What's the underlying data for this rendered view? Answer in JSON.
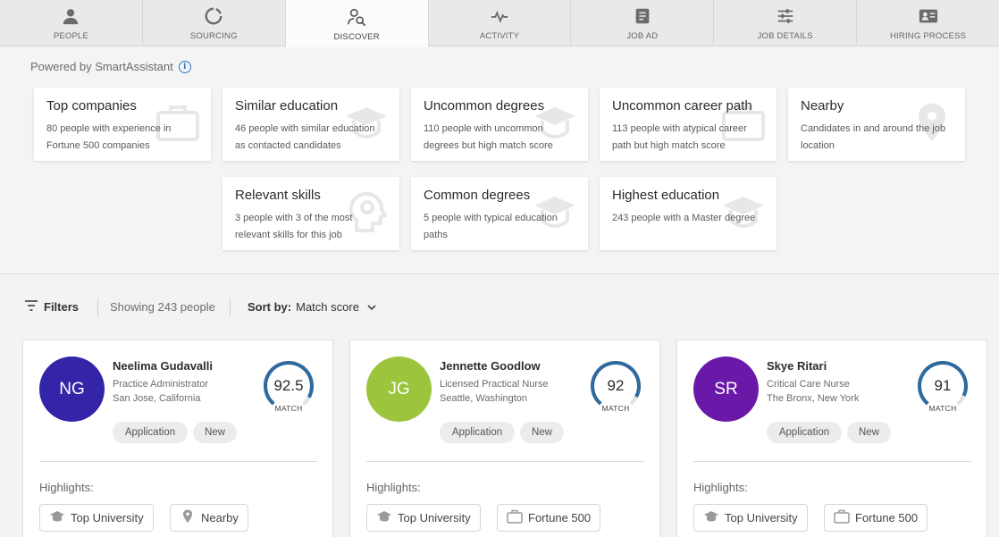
{
  "tabs": [
    {
      "label": "PEOPLE",
      "icon": "person-icon",
      "active": false
    },
    {
      "label": "SOURCING",
      "icon": "sourcing-icon",
      "active": false
    },
    {
      "label": "DISCOVER",
      "icon": "discover-icon",
      "active": true
    },
    {
      "label": "ACTIVITY",
      "icon": "activity-icon",
      "active": false
    },
    {
      "label": "JOB AD",
      "icon": "document-icon",
      "active": false
    },
    {
      "label": "JOB DETAILS",
      "icon": "sliders-icon",
      "active": false
    },
    {
      "label": "HIRING PROCESS",
      "icon": "id-card-icon",
      "active": false
    }
  ],
  "insights": {
    "powered_by": "Powered by SmartAssistant",
    "cards": [
      {
        "title": "Top companies",
        "desc": "80 people with experience in Fortune 500 companies",
        "icon": "briefcase-icon"
      },
      {
        "title": "Similar education",
        "desc": "46 people with similar education as contacted candidates",
        "icon": "graduation-cap-icon"
      },
      {
        "title": "Uncommon degrees",
        "desc": "110 people with uncommon degrees but high match score",
        "icon": "graduation-cap-icon"
      },
      {
        "title": "Uncommon career path",
        "desc": "113 people with atypical career path but high match score",
        "icon": "briefcase-icon"
      },
      {
        "title": "Nearby",
        "desc": "Candidates in and around the job location",
        "icon": "location-pin-icon"
      },
      {
        "title": "Relevant skills",
        "desc": "3 people with 3 of the most relevant skills for this job",
        "icon": "head-gear-icon"
      },
      {
        "title": "Common degrees",
        "desc": "5 people with typical education paths",
        "icon": "graduation-cap-icon"
      },
      {
        "title": "Highest education",
        "desc": "243 people with a Master degree",
        "icon": "graduation-cap-icon"
      }
    ]
  },
  "toolbar": {
    "filters_label": "Filters",
    "showing": "Showing 243 people",
    "sort_label": "Sort by:",
    "sort_value": "Match score"
  },
  "candidates": [
    {
      "initials": "NG",
      "avatar_color": "#3424a8",
      "name": "Neelima Gudavalli",
      "role": "Practice Administrator",
      "location": "San Jose, California",
      "score": "92.5",
      "score_fraction": 0.925,
      "match_label": "MATCH",
      "tags": [
        "Application",
        "New"
      ],
      "highlights_label": "Highlights:",
      "highlights": [
        {
          "label": "Top University",
          "icon": "graduation-cap-icon"
        },
        {
          "label": "Nearby",
          "icon": "location-pin-icon"
        }
      ]
    },
    {
      "initials": "JG",
      "avatar_color": "#9cc43d",
      "name": "Jennette Goodlow",
      "role": "Licensed Practical Nurse",
      "location": "Seattle, Washington",
      "score": "92",
      "score_fraction": 0.92,
      "match_label": "MATCH",
      "tags": [
        "Application",
        "New"
      ],
      "highlights_label": "Highlights:",
      "highlights": [
        {
          "label": "Top University",
          "icon": "graduation-cap-icon"
        },
        {
          "label": "Fortune 500",
          "icon": "briefcase-icon"
        }
      ]
    },
    {
      "initials": "SR",
      "avatar_color": "#6a18a8",
      "name": "Skye Ritari",
      "role": "Critical Care Nurse",
      "location": "The Bronx, New York",
      "score": "91",
      "score_fraction": 0.91,
      "match_label": "MATCH",
      "tags": [
        "Application",
        "New"
      ],
      "highlights_label": "Highlights:",
      "highlights": [
        {
          "label": "Top University",
          "icon": "graduation-cap-icon"
        },
        {
          "label": "Fortune 500",
          "icon": "briefcase-icon"
        }
      ]
    }
  ],
  "colors": {
    "gauge": "#2e6a9e",
    "gauge_track": "#e3e3e3",
    "info": "#2e78c7"
  }
}
